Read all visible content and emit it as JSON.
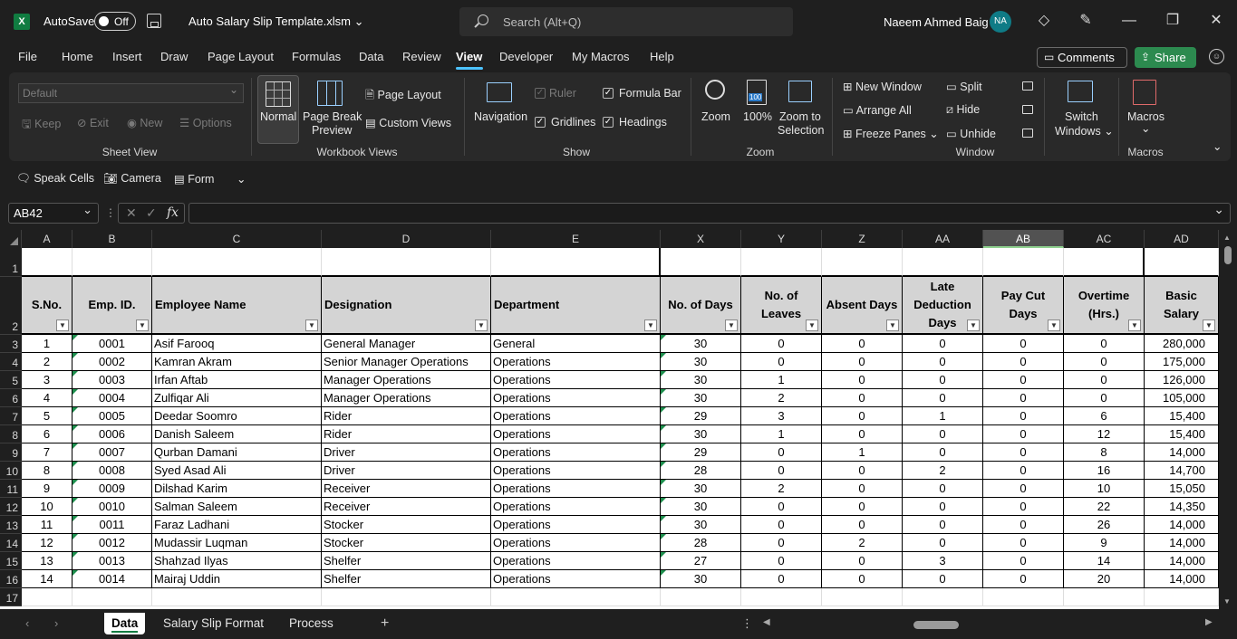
{
  "titlebar": {
    "autosave_label": "AutoSave",
    "autosave_state": "Off",
    "doc_title": "Auto Salary Slip Template.xlsm",
    "search_placeholder": "Search (Alt+Q)",
    "user_name": "Naeem Ahmed Baig",
    "user_initials": "NA"
  },
  "menu": {
    "items": [
      "File",
      "Home",
      "Insert",
      "Draw",
      "Page Layout",
      "Formulas",
      "Data",
      "Review",
      "View",
      "Developer",
      "My Macros",
      "Help"
    ],
    "active": "View",
    "comments_label": "Comments",
    "share_label": "Share"
  },
  "ribbon": {
    "sheet_view": {
      "select_value": "Default",
      "keep": "Keep",
      "exit": "Exit",
      "new": "New",
      "options": "Options",
      "label": "Sheet View"
    },
    "workbook_views": {
      "normal": "Normal",
      "page_break_1": "Page Break",
      "page_break_2": "Preview",
      "page_layout": "Page Layout",
      "custom_views": "Custom Views",
      "label": "Workbook Views"
    },
    "show": {
      "navigation": "Navigation",
      "ruler": "Ruler",
      "formula_bar": "Formula Bar",
      "gridlines": "Gridlines",
      "headings": "Headings",
      "label": "Show"
    },
    "zoom": {
      "zoom": "Zoom",
      "hundred": "100%",
      "hundred_badge": "100",
      "zoom_sel_1": "Zoom to",
      "zoom_sel_2": "Selection",
      "label": "Zoom"
    },
    "window": {
      "new_window": "New Window",
      "arrange_all": "Arrange All",
      "freeze_panes": "Freeze Panes",
      "split": "Split",
      "hide": "Hide",
      "unhide": "Unhide",
      "switch_1": "Switch",
      "switch_2": "Windows",
      "label": "Window"
    },
    "macros": {
      "macros": "Macros",
      "label": "Macros"
    }
  },
  "qat": {
    "speak_cells": "Speak Cells",
    "camera": "Camera",
    "form": "Form"
  },
  "formula_bar": {
    "name_box": "AB42",
    "fx": "fx",
    "value": ""
  },
  "grid": {
    "columns": [
      "A",
      "B",
      "C",
      "D",
      "E",
      "X",
      "Y",
      "Z",
      "AA",
      "AB",
      "AC",
      "AD"
    ],
    "selected_column": "AB",
    "row_numbers": [
      "1",
      "2",
      "3",
      "4",
      "5",
      "6",
      "7",
      "8",
      "9",
      "10",
      "11",
      "12",
      "13",
      "14",
      "15",
      "16",
      "17"
    ],
    "headers": [
      "S.No.",
      "Emp. ID.",
      "Employee Name",
      "Designation",
      "Department",
      "No. of Days",
      "No. of Leaves",
      "Absent Days",
      "Late Deduction Days",
      "Pay Cut Days",
      "Overtime (Hrs.)",
      "Basic Salary"
    ],
    "rows": [
      [
        "1",
        "0001",
        "Asif Farooq",
        "General Manager",
        "General",
        "30",
        "0",
        "0",
        "0",
        "0",
        "0",
        "280,000"
      ],
      [
        "2",
        "0002",
        "Kamran Akram",
        "Senior Manager Operations",
        "Operations",
        "30",
        "0",
        "0",
        "0",
        "0",
        "0",
        "175,000"
      ],
      [
        "3",
        "0003",
        "Irfan Aftab",
        "Manager Operations",
        "Operations",
        "30",
        "1",
        "0",
        "0",
        "0",
        "0",
        "126,000"
      ],
      [
        "4",
        "0004",
        "Zulfiqar Ali",
        "Manager Operations",
        "Operations",
        "30",
        "2",
        "0",
        "0",
        "0",
        "0",
        "105,000"
      ],
      [
        "5",
        "0005",
        "Deedar Soomro",
        "Rider",
        "Operations",
        "29",
        "3",
        "0",
        "1",
        "0",
        "6",
        "15,400"
      ],
      [
        "6",
        "0006",
        "Danish Saleem",
        "Rider",
        "Operations",
        "30",
        "1",
        "0",
        "0",
        "0",
        "12",
        "15,400"
      ],
      [
        "7",
        "0007",
        "Qurban Damani",
        "Driver",
        "Operations",
        "29",
        "0",
        "1",
        "0",
        "0",
        "8",
        "14,000"
      ],
      [
        "8",
        "0008",
        "Syed Asad Ali",
        "Driver",
        "Operations",
        "28",
        "0",
        "0",
        "2",
        "0",
        "16",
        "14,700"
      ],
      [
        "9",
        "0009",
        "Dilshad Karim",
        "Receiver",
        "Operations",
        "30",
        "2",
        "0",
        "0",
        "0",
        "10",
        "15,050"
      ],
      [
        "10",
        "0010",
        "Salman Saleem",
        "Receiver",
        "Operations",
        "30",
        "0",
        "0",
        "0",
        "0",
        "22",
        "14,350"
      ],
      [
        "11",
        "0011",
        "Faraz Ladhani",
        "Stocker",
        "Operations",
        "30",
        "0",
        "0",
        "0",
        "0",
        "26",
        "14,000"
      ],
      [
        "12",
        "0012",
        "Mudassir Luqman",
        "Stocker",
        "Operations",
        "28",
        "0",
        "2",
        "0",
        "0",
        "9",
        "14,000"
      ],
      [
        "13",
        "0013",
        "Shahzad Ilyas",
        "Shelfer",
        "Operations",
        "27",
        "0",
        "0",
        "3",
        "0",
        "14",
        "14,000"
      ],
      [
        "14",
        "0014",
        "Mairaj Uddin",
        "Shelfer",
        "Operations",
        "30",
        "0",
        "0",
        "0",
        "0",
        "20",
        "14,000"
      ]
    ]
  },
  "sheets": {
    "tabs": [
      "Data",
      "Salary Slip Format",
      "Process"
    ],
    "active": "Data"
  }
}
